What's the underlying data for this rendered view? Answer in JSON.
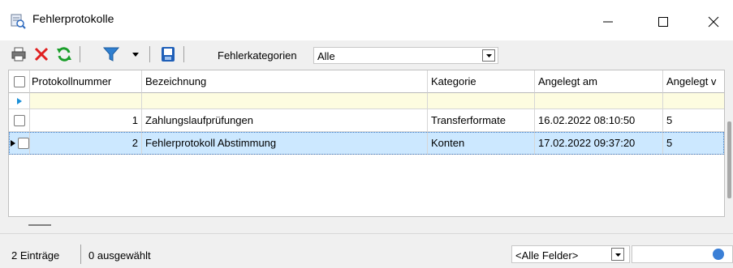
{
  "window": {
    "title": "Fehlerprotokolle",
    "controls": [
      "minimize",
      "maximize",
      "close"
    ]
  },
  "toolbar": {
    "buttons": [
      {
        "name": "print",
        "icon": "printer-icon"
      },
      {
        "name": "delete",
        "icon": "red-x-icon"
      },
      {
        "name": "refresh",
        "icon": "green-refresh-icon"
      },
      {
        "name": "filter",
        "icon": "funnel-icon"
      },
      {
        "name": "filter-dropdown",
        "icon": "chevron-down-icon"
      },
      {
        "name": "save",
        "icon": "floppy-icon"
      }
    ],
    "filter_label": "Fehlerkategorien",
    "filter_value": "Alle"
  },
  "grid": {
    "columns": [
      "Protokollnummer",
      "Bezeichnung",
      "Kategorie",
      "Angelegt am",
      "Angelegt v"
    ],
    "rows": [
      {
        "number": "1",
        "name": "Zahlungslaufprüfungen",
        "category": "Transferformate",
        "created": "16.02.2022 08:10:50",
        "by": "5",
        "selected": false
      },
      {
        "number": "2",
        "name": "Fehlerprotokoll Abstimmung",
        "category": "Konten",
        "created": "17.02.2022 09:37:20",
        "by": "5",
        "selected": true
      }
    ]
  },
  "status": {
    "count": "2 Einträge",
    "selected": "0 ausgewählt",
    "field_select": "<Alle Felder>",
    "search_value": ""
  },
  "colors": {
    "accent": "#0078d7",
    "selected_row": "#cce8ff",
    "new_row": "#fdfce0",
    "delete_red": "#e02020",
    "refresh_green": "#1a9e2a",
    "filter_blue": "#2f7fd0"
  }
}
